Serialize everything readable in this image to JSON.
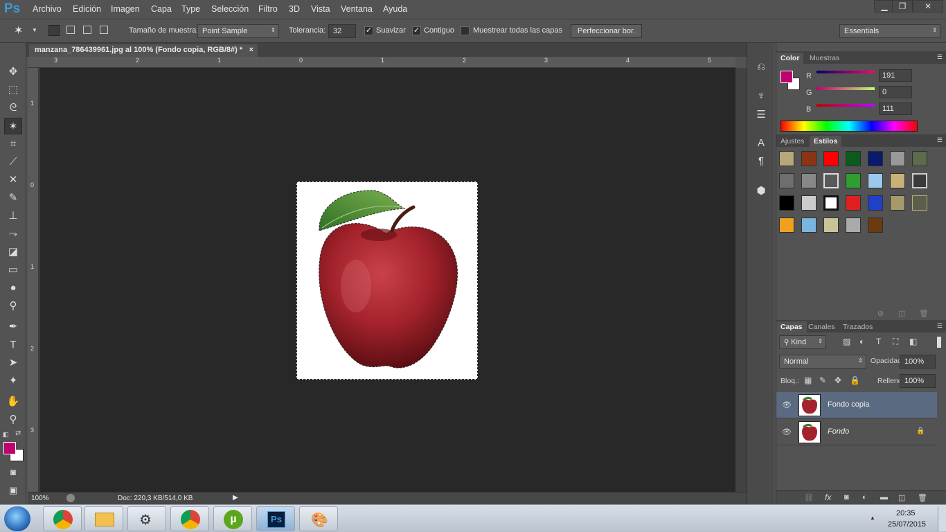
{
  "app": {
    "logo": "Ps"
  },
  "menu": [
    "Archivo",
    "Edición",
    "Imagen",
    "Capa",
    "Type",
    "Selección",
    "Filtro",
    "3D",
    "Vista",
    "Ventana",
    "Ayuda"
  ],
  "window_controls": {
    "minimize": "▁",
    "restore": "❐",
    "close": "✕"
  },
  "options": {
    "sample_size_label": "Tamaño de muestra:",
    "sample_size_value": "Point Sample",
    "tolerance_label": "Tolerancia:",
    "tolerance_value": "32",
    "antialias_label": "Suavizar",
    "contiguous_label": "Contiguo",
    "sample_all_label": "Muestrear todas las capas",
    "refine_label": "Perfeccionar bor.",
    "workspace": "Essentials",
    "check_mark": "✓"
  },
  "document": {
    "tab_title": "manzana_786439961.jpg al 100% (Fondo copia, RGB/8#) *",
    "tab_close": "×",
    "ruler_top": [
      "3",
      "2",
      "1",
      "0",
      "1",
      "2",
      "3",
      "4",
      "5"
    ],
    "ruler_left": [
      "1",
      "0",
      "1",
      "2",
      "3"
    ],
    "zoom": "100%",
    "doc_info": "Doc: 220,3 KB/514,0 KB"
  },
  "colors": {
    "foreground": "#bf006f",
    "background": "#ffffff",
    "accent": "#3d9ad8"
  },
  "color_panel": {
    "tabs": [
      "Color",
      "Muestras"
    ],
    "r_label": "R",
    "r_value": "191",
    "g_label": "G",
    "g_value": "0",
    "b_label": "B",
    "b_value": "111"
  },
  "styles_panel": {
    "tabs": [
      "Ajustes",
      "Estilos"
    ]
  },
  "layers_panel": {
    "tabs": [
      "Capas",
      "Canales",
      "Trazados"
    ],
    "filter_kind": "Kind",
    "blend_mode": "Normal",
    "opacity_label": "Opacidad:",
    "opacity_value": "100%",
    "lock_label": "Bloq.:",
    "fill_label": "Relleno:",
    "fill_value": "100%",
    "layers": [
      {
        "name": "Fondo copia",
        "selected": true
      },
      {
        "name": "Fondo",
        "selected": false
      }
    ]
  },
  "taskbar": {
    "clock_time": "20:35",
    "clock_date": "25/07/2015",
    "ps_label": "Ps"
  }
}
